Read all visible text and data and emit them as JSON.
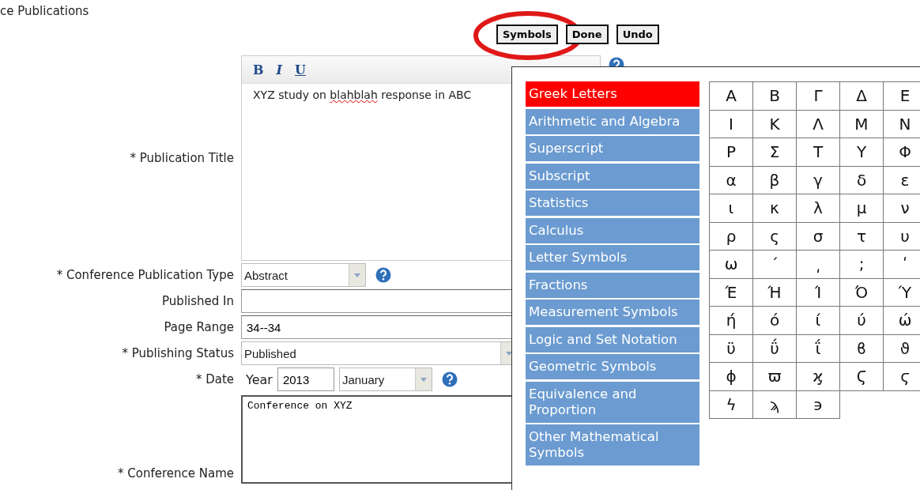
{
  "page_title": "ce Publications",
  "toolbar_buttons": [
    {
      "label": "Symbols",
      "circled": true
    },
    {
      "label": "Done",
      "circled": false
    },
    {
      "label": "Undo",
      "circled": false
    }
  ],
  "fields": [
    {
      "kind": "editor",
      "label": "* Publication Title",
      "format_buttons": [
        "B",
        "I",
        "U"
      ],
      "help": true,
      "value": [
        {
          "text": "XYZ study on ",
          "misspelled": false
        },
        {
          "text": "blahblah",
          "misspelled": true
        },
        {
          "text": " response in ABC",
          "misspelled": false
        }
      ]
    },
    {
      "kind": "select",
      "label": "* Conference Publication Type",
      "value": "Abstract",
      "wide": false,
      "help": true
    },
    {
      "kind": "text",
      "label": "Published In"
    },
    {
      "kind": "text",
      "label": "Page Range",
      "value": "34--34"
    },
    {
      "kind": "select",
      "label": "* Publishing Status",
      "value": "Published",
      "wide": true,
      "help": false
    },
    {
      "kind": "date",
      "label": "* Date",
      "year_label": "Year",
      "year": "2013",
      "month": "January",
      "help": true
    },
    {
      "kind": "textarea",
      "label": "* Conference Name",
      "value": "Conference on XYZ"
    }
  ],
  "symbols_popup": {
    "categories": [
      {
        "label": "Greek Letters",
        "selected": true
      },
      {
        "label": "Arithmetic and Algebra",
        "selected": false
      },
      {
        "label": "Superscript",
        "selected": false
      },
      {
        "label": "Subscript",
        "selected": false
      },
      {
        "label": "Statistics",
        "selected": false
      },
      {
        "label": "Calculus",
        "selected": false
      },
      {
        "label": "Letter Symbols",
        "selected": false
      },
      {
        "label": "Fractions",
        "selected": false
      },
      {
        "label": "Measurement Symbols",
        "selected": false
      },
      {
        "label": "Logic and Set Notation",
        "selected": false
      },
      {
        "label": "Geometric Symbols",
        "selected": false
      },
      {
        "label": "Equivalence and Proportion",
        "selected": false
      },
      {
        "label": "Other Mathematical Symbols",
        "selected": false
      }
    ],
    "symbols": [
      [
        "Α",
        "Β",
        "Γ",
        "Δ",
        "Ε"
      ],
      [
        "Ι",
        "Κ",
        "Λ",
        "Μ",
        "Ν"
      ],
      [
        "Ρ",
        "Σ",
        "Τ",
        "Υ",
        "Φ"
      ],
      [
        "α",
        "β",
        "γ",
        "δ",
        "ε"
      ],
      [
        "ι",
        "κ",
        "λ",
        "μ",
        "ν"
      ],
      [
        "ρ",
        "ς",
        "σ",
        "τ",
        "υ"
      ],
      [
        "ω",
        "΄",
        "͵",
        ";",
        "ʹ"
      ],
      [
        "Έ",
        "Ή",
        "Ί",
        "Ό",
        "Ύ"
      ],
      [
        "ή",
        "ό",
        "ί",
        "ύ",
        "ώ"
      ],
      [
        "ϋ",
        "ΰ",
        "ΐ",
        "ϐ",
        "ϑ"
      ],
      [
        "ϕ",
        "ϖ",
        "ϗ",
        "Ϛ",
        "ϛ"
      ],
      [
        "ϟ",
        "ϡ",
        "϶"
      ]
    ]
  }
}
